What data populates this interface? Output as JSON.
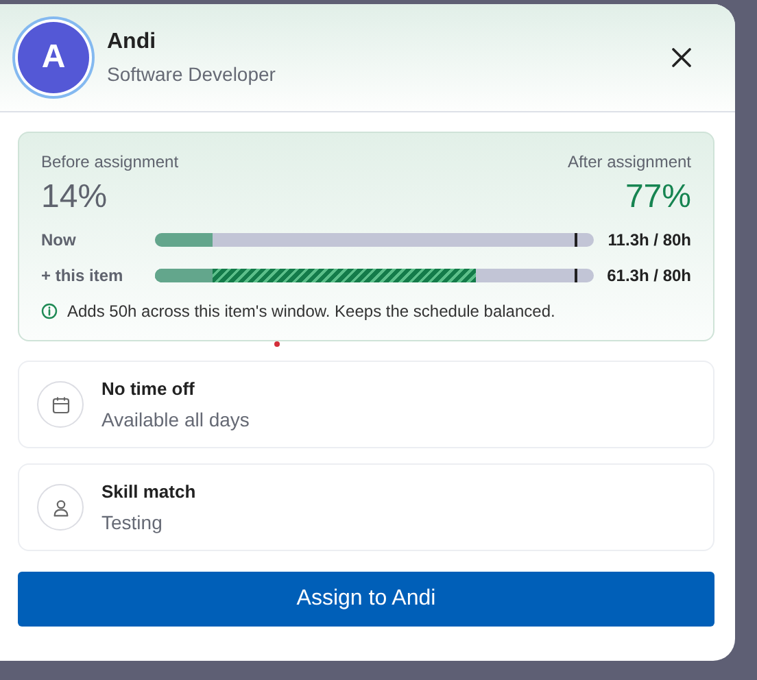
{
  "person": {
    "initial": "A",
    "name": "Andi",
    "role": "Software Developer"
  },
  "load": {
    "before_label": "Before assignment",
    "before_value": "14%",
    "after_label": "After assignment",
    "after_value": "77%",
    "rows": [
      {
        "kind": "now",
        "label": "Now",
        "level": 0.13,
        "reading": "11.3h / 80h"
      },
      {
        "kind": "added",
        "label": "+ this item",
        "level": 0.73,
        "reading": "61.3h / 80h"
      }
    ],
    "note": "Adds 50h across this item's window. Keeps the schedule balanced."
  },
  "checks": [
    {
      "kind": "calendar",
      "title": "No time off",
      "detail": "Available all days"
    },
    {
      "kind": "person",
      "title": "Skill match",
      "detail": "Testing"
    }
  ],
  "assign_button": "Assign to Andi"
}
